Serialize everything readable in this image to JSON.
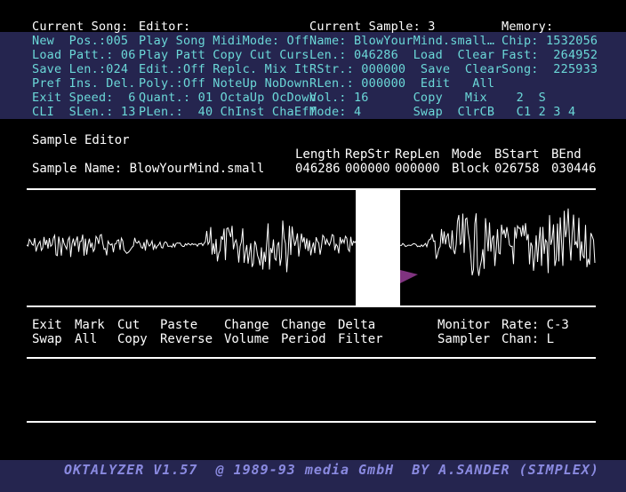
{
  "header": {
    "col1": [
      "Current Song:",
      "New  Pos.:005",
      "Load Patt.: 06",
      "Save Len.:024",
      "Pref Ins. Del.",
      "Exit Speed:  6",
      "CLI  SLen.: 13"
    ],
    "col2": [
      "Editor:",
      "Play Song MidiMode: Off",
      "Play Patt Copy Cut Curs",
      "Edit.:Off Replc. Mix It",
      "Poly.:Off NoteUp NoDown",
      "Quant.: 01 OctaUp OcDown",
      "PLen.:  40 ChInst ChaEff"
    ],
    "col3": [
      "Current Sample: 3",
      "Name: BlowYourMind.small…",
      "Len.: 046286  Load  Clear",
      "RStr.: 000000  Save  Clear",
      "RLen.: 000000  Edit   All",
      "Vol.: 16      Copy   Mix",
      "Mode: 4       Swap  ClrCB"
    ],
    "col4": [
      "Memory:",
      "Chip: 1532056",
      "Fast:  264952",
      "Song:  225933",
      "",
      "  2  S",
      "  C1 2 3 4"
    ]
  },
  "sample_editor": {
    "title": "Sample Editor",
    "name_line": "Sample Name: BlowYourMind.small",
    "columns": [
      {
        "header": "Length",
        "value": "046286"
      },
      {
        "header": "RepStr",
        "value": "000000"
      },
      {
        "header": "RepLen",
        "value": "000000"
      },
      {
        "header": "Mode",
        "value": "Block"
      },
      {
        "header": "BStart",
        "value": "026758"
      },
      {
        "header": "BEnd",
        "value": "030446"
      }
    ]
  },
  "commands": {
    "top": [
      "Exit",
      "Mark",
      "Cut",
      "Paste",
      "Change",
      "Change",
      "Delta",
      "Monitor",
      "Rate: C-3"
    ],
    "bottom": [
      "Swap",
      "All",
      "Copy",
      "Reverse",
      "Volume",
      "Period",
      "Filter",
      "Sampler",
      "Chan: L"
    ]
  },
  "footer": "OKTALYZER V1.57  @ 1989-93 media GmbH  BY A.SANDER (SIMPLEX)"
}
